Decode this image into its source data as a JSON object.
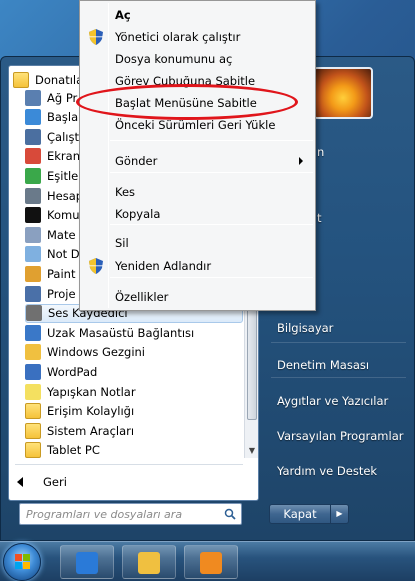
{
  "context_menu": {
    "items": [
      {
        "label": "Aç",
        "bold": true,
        "shield": false
      },
      {
        "label": "Yönetici olarak çalıştır",
        "shield": true
      },
      {
        "label": "Dosya konumunu aç",
        "shield": false
      },
      {
        "label": "Görev Çubuğuna Sabitle",
        "shield": false
      },
      {
        "label": "Başlat Menüsüne Sabitle",
        "shield": false,
        "highlighted_annotation": true
      },
      {
        "label": "Önceki Sürümleri Geri Yükle",
        "shield": false
      },
      {
        "label": "Gönder",
        "shield": false,
        "submenu": true
      },
      {
        "label": "Kes",
        "shield": false
      },
      {
        "label": "Kopyala",
        "shield": false
      },
      {
        "label": "Sil",
        "shield": false
      },
      {
        "label": "Yeniden Adlandır",
        "shield": true
      },
      {
        "label": "Özellikler",
        "shield": false
      }
    ]
  },
  "programs": {
    "folder_header": "Donatılar",
    "items": [
      {
        "label": "Ağ Pr",
        "icon": "network-projector-icon",
        "color": "#5a7fb0"
      },
      {
        "label": "Başla",
        "icon": "getting-started-icon",
        "color": "#3b8ad8"
      },
      {
        "label": "Çalışt",
        "icon": "run-icon",
        "color": "#4b6fa0"
      },
      {
        "label": "Ekran",
        "icon": "snipping-tool-icon",
        "color": "#d84a3a"
      },
      {
        "label": "Eşitle",
        "icon": "sync-center-icon",
        "color": "#3aa84a"
      },
      {
        "label": "Hesap",
        "icon": "calculator-icon",
        "color": "#6a7a8a"
      },
      {
        "label": "Komu",
        "icon": "command-prompt-icon",
        "color": "#111111"
      },
      {
        "label": "Mate",
        "icon": "math-input-icon",
        "color": "#8aa0c0"
      },
      {
        "label": "Not D",
        "icon": "notepad-icon",
        "color": "#7fb0e0"
      },
      {
        "label": "Paint",
        "icon": "paint-icon",
        "color": "#e0a030"
      },
      {
        "label": "Proje",
        "icon": "projector-icon",
        "color": "#4a70a8"
      },
      {
        "label": "Ses Kaydedici",
        "icon": "sound-recorder-icon",
        "color": "#707070",
        "selected": true
      },
      {
        "label": "Uzak Masaüstü Bağlantısı",
        "icon": "remote-desktop-icon",
        "color": "#3a78c8"
      },
      {
        "label": "Windows Gezgini",
        "icon": "explorer-folder-icon",
        "color": "#f0c040"
      },
      {
        "label": "WordPad",
        "icon": "wordpad-icon",
        "color": "#3a70c0"
      },
      {
        "label": "Yapışkan Notlar",
        "icon": "sticky-notes-icon",
        "color": "#f4e060"
      },
      {
        "label": "Erişim Kolaylığı",
        "icon": "folder-icon",
        "color": "#f5c23a",
        "folder": true
      },
      {
        "label": "Sistem Araçları",
        "icon": "folder-icon",
        "color": "#f5c23a",
        "folder": true
      },
      {
        "label": "Tablet PC",
        "icon": "folder-icon",
        "color": "#f5c23a",
        "folder": true
      }
    ],
    "back_label": "Geri"
  },
  "search": {
    "placeholder": "Programları ve dosyaları ara"
  },
  "right_panel": {
    "items": [
      {
        "label": "n"
      },
      {
        "label": "t"
      },
      {
        "label": "Bilgisayar"
      },
      {
        "label": "Denetim Masası"
      },
      {
        "label": "Aygıtlar ve Yazıcılar"
      },
      {
        "label": "Varsayılan Programlar"
      },
      {
        "label": "Yardım ve Destek"
      }
    ],
    "shutdown_label": "Kapat"
  },
  "taskbar": {
    "buttons": [
      {
        "name": "internet-explorer-icon",
        "color": "#2a7ad8"
      },
      {
        "name": "windows-explorer-icon",
        "color": "#f0c040"
      },
      {
        "name": "media-player-icon",
        "color": "#f08a20"
      }
    ]
  }
}
